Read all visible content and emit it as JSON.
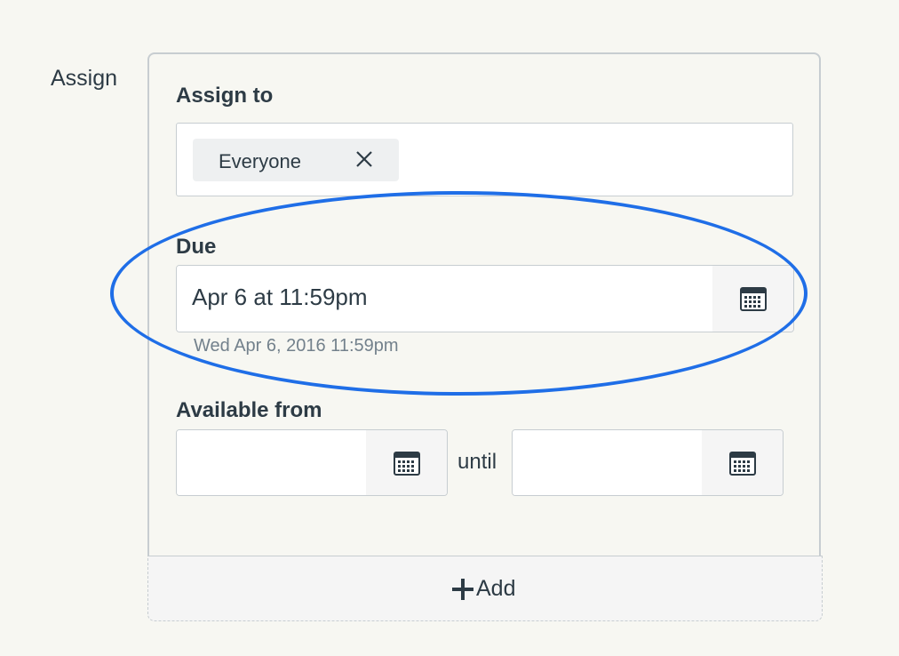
{
  "section": {
    "label": "Assign"
  },
  "assign_to": {
    "label": "Assign to",
    "tokens": [
      {
        "label": "Everyone",
        "remove_icon": "close-icon"
      }
    ]
  },
  "due": {
    "label": "Due",
    "value": "Apr 6 at 11:59pm",
    "helper": "Wed Apr 6, 2016 11:59pm",
    "calendar_icon": "calendar-icon"
  },
  "available": {
    "label": "Available from",
    "from_value": "",
    "until_label": "until",
    "until_value": "",
    "calendar_icon": "calendar-icon"
  },
  "add": {
    "label": "Add",
    "icon": "plus-icon"
  },
  "colors": {
    "background": "#f7f7f2",
    "border": "#c7cdd1",
    "text": "#2d3b45",
    "muted": "#73818c",
    "highlight": "#1f6ee7"
  }
}
